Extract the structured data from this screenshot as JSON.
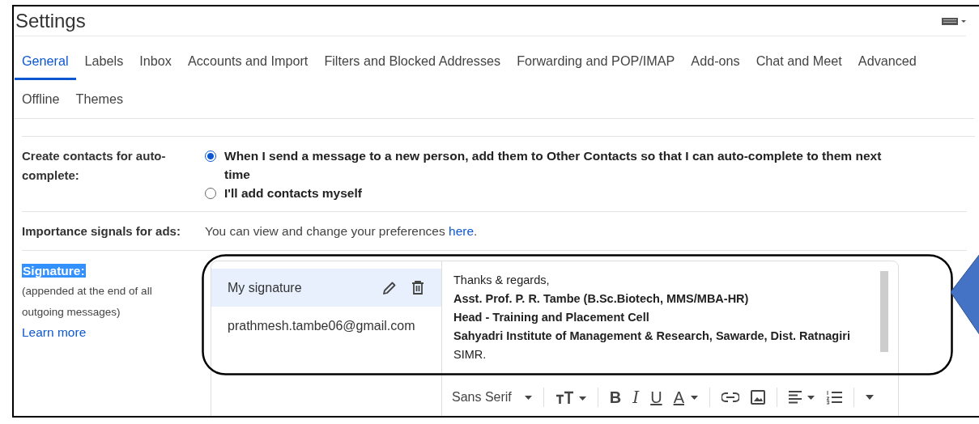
{
  "window": {
    "title": "Settings"
  },
  "tabs": [
    {
      "label": "General",
      "selected": true
    },
    {
      "label": "Labels",
      "selected": false
    },
    {
      "label": "Inbox",
      "selected": false
    },
    {
      "label": "Accounts and Import",
      "selected": false
    },
    {
      "label": "Filters and Blocked Addresses",
      "selected": false
    },
    {
      "label": "Forwarding and POP/IMAP",
      "selected": false
    },
    {
      "label": "Add-ons",
      "selected": false
    },
    {
      "label": "Chat and Meet",
      "selected": false
    },
    {
      "label": "Advanced",
      "selected": false
    },
    {
      "label": "Offline",
      "selected": false
    },
    {
      "label": "Themes",
      "selected": false
    }
  ],
  "settings": [
    {
      "kind": "radio",
      "label": "Create contacts for auto-complete:",
      "options": [
        {
          "label": "When I send a message to a new person, add them to Other Contacts so that I can auto-complete to them next time",
          "selected": true
        },
        {
          "label": "I'll add contacts myself",
          "selected": false
        }
      ]
    },
    {
      "kind": "text",
      "label": "Importance signals for ads:",
      "text": "You can view and change your preferences ",
      "link": "here",
      "after": "."
    }
  ],
  "signature": {
    "label": "Signature:",
    "highlighted": true,
    "note": "(appended at the end of all outgoing messages)",
    "link": "Learn more",
    "list": [
      {
        "label": "My signature",
        "selected": true
      },
      {
        "label": "prathmesh.tambe06@gmail.com",
        "selected": false
      }
    ],
    "lines": [
      {
        "text": "Thanks & regards,",
        "bold": false
      },
      {
        "text": "Asst. Prof. P. R. Tambe (B.Sc.Biotech, MMS/MBA-HR)",
        "bold": true
      },
      {
        "text": "Head - Training and Placement Cell",
        "bold": true
      },
      {
        "text": "Sahyadri Institute of Management & Research, Sawarde, Dist. Ratnagiri",
        "bold": true
      },
      {
        "text": "SIMR.",
        "bold": false
      }
    ],
    "toolbar": {
      "font": "Sans Serif",
      "format_buttons": [
        {
          "kind": "bold",
          "label": "B"
        },
        {
          "kind": "italic",
          "label": "I"
        },
        {
          "kind": "underline",
          "label": "U"
        },
        {
          "kind": "color",
          "label": "A"
        }
      ]
    }
  }
}
